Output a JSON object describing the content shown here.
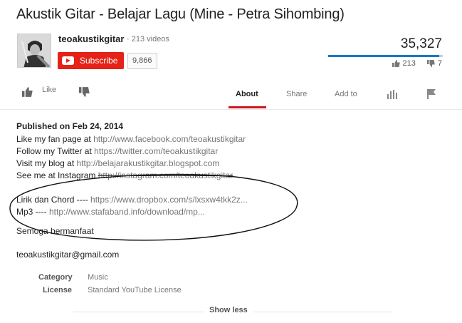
{
  "video": {
    "title": "Akustik Gitar - Belajar Lagu (Mine - Petra Sihombing)",
    "views": "35,327",
    "likes": "213",
    "dislikes": "7",
    "like_ratio": 0.968
  },
  "channel": {
    "name": "teoakustikgitar",
    "video_count": "· 213 videos",
    "subscribe_label": "Subscribe",
    "subscriber_count": "9,866"
  },
  "actions": {
    "like_label": "Like",
    "tabs": [
      {
        "label": "About",
        "active": true
      },
      {
        "label": "Share",
        "active": false
      },
      {
        "label": "Add to",
        "active": false
      }
    ]
  },
  "description": {
    "published": "Published on Feb 24, 2014",
    "lines": [
      {
        "text": "Like my fan page at ",
        "link": "http://www.facebook.com/teoakustikgitar"
      },
      {
        "text": "Follow my Twitter at ",
        "link": "https://twitter.com/teoakustikgitar"
      },
      {
        "text": "Visit my blog at ",
        "link": "http://belajarakustikgitar.blogspot.com"
      },
      {
        "text": "See me at Instagram ",
        "link": "http://instagram.com/teoakustikgitar"
      },
      {
        "text": "Lirik dan Chord ---- ",
        "link": "https://www.dropbox.com/s/lxsxw4tkk2z..."
      },
      {
        "text": "Mp3 ---- ",
        "link": "http://www.stafaband.info/download/mp..."
      },
      {
        "text": "Semoga bermanfaat"
      },
      {
        "text": "teoakustikgitar@gmail.com"
      }
    ]
  },
  "meta": {
    "category_label": "Category",
    "category_value": "Music",
    "license_label": "License",
    "license_value": "Standard YouTube License"
  },
  "show_less_label": "Show less",
  "colors": {
    "accent": "#cc181e",
    "subscribe": "#e62117",
    "sentiment": "#167ac6",
    "link": "#767676"
  }
}
